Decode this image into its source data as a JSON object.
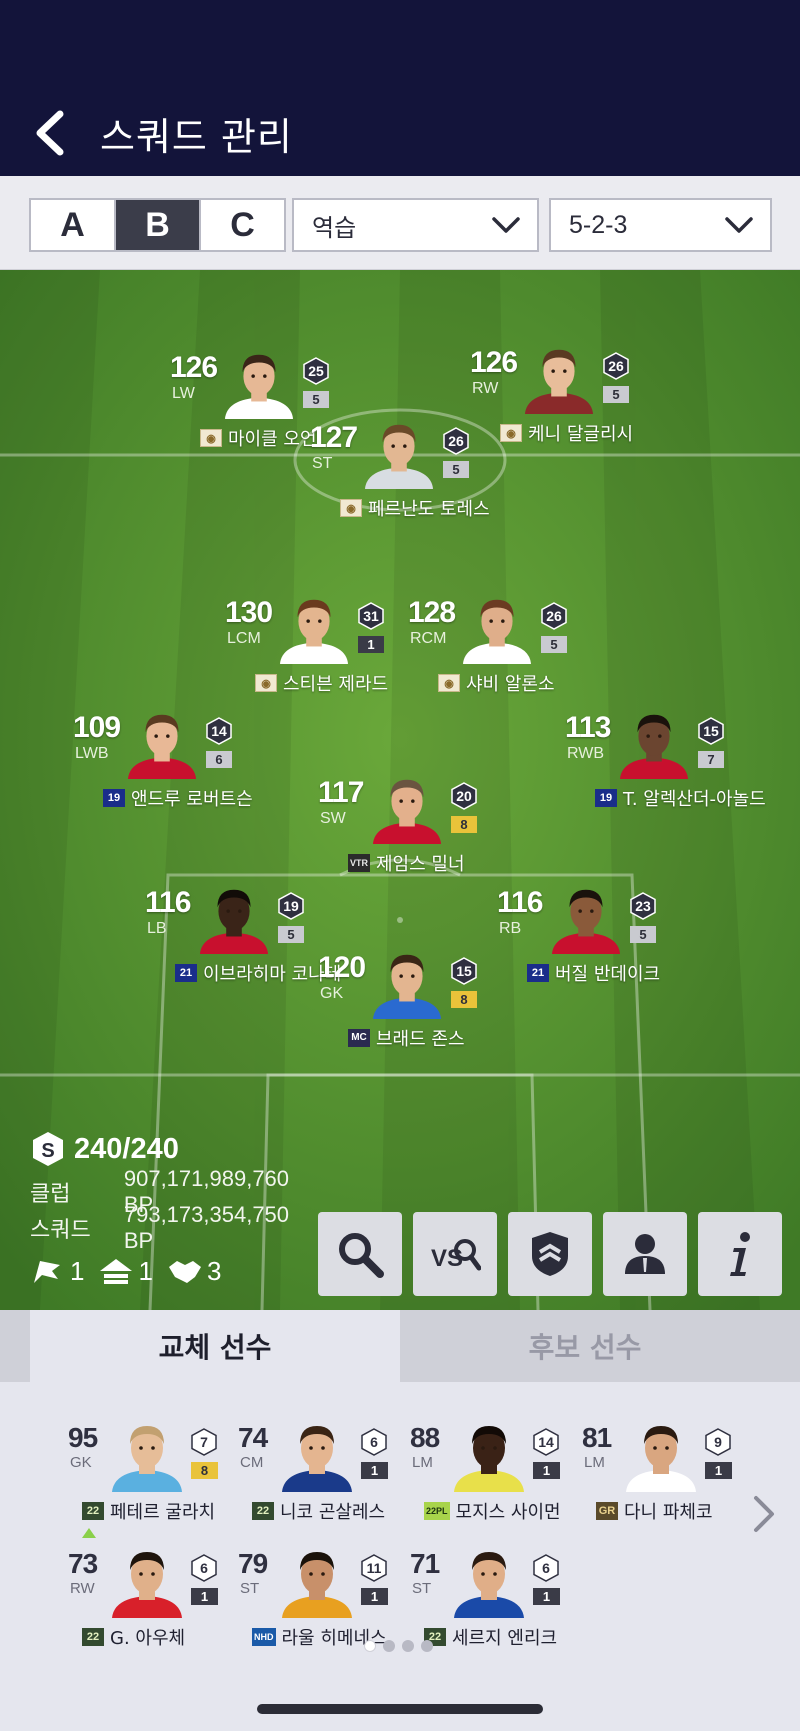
{
  "header": {
    "title": "스쿼드 관리"
  },
  "squad_tabs": [
    {
      "label": "A",
      "active": false
    },
    {
      "label": "B",
      "active": true
    },
    {
      "label": "C",
      "active": false
    }
  ],
  "tactic": {
    "selected": "역습"
  },
  "formation": {
    "selected": "5-2-3"
  },
  "pitch_players": [
    {
      "rating": "126",
      "pos": "LW",
      "badge": "25",
      "level": "5",
      "level_style": "gray",
      "season": "icon",
      "name": "마이클 오언",
      "kit": "#ffffff",
      "skin": "#e6b895",
      "hair": "#3a2518"
    },
    {
      "rating": "126",
      "pos": "RW",
      "badge": "26",
      "level": "5",
      "level_style": "gray",
      "season": "icon",
      "name": "케니 달글리시",
      "kit": "#8a2a2a",
      "skin": "#e8bd9a",
      "hair": "#5a3a22"
    },
    {
      "rating": "127",
      "pos": "ST",
      "badge": "26",
      "level": "5",
      "level_style": "gray",
      "season": "icon",
      "name": "페르난도 토레스",
      "kit": "#d8dde2",
      "skin": "#e2b792",
      "hair": "#6a4a28"
    },
    {
      "rating": "130",
      "pos": "LCM",
      "badge": "31",
      "level": "1",
      "level_style": "dark",
      "season": "icon",
      "name": "스티븐 제라드",
      "kit": "#ffffff",
      "skin": "#e3b58f",
      "hair": "#6a3a1e"
    },
    {
      "rating": "128",
      "pos": "RCM",
      "badge": "26",
      "level": "5",
      "level_style": "gray",
      "season": "icon",
      "name": "샤비 알론소",
      "kit": "#ffffff",
      "skin": "#dfae8a",
      "hair": "#6b3b22"
    },
    {
      "rating": "109",
      "pos": "LWB",
      "badge": "14",
      "level": "6",
      "level_style": "gray",
      "season": "19",
      "name": "앤드루 로버트슨",
      "kit": "#c8102e",
      "skin": "#e8b896",
      "hair": "#5a3a20"
    },
    {
      "rating": "113",
      "pos": "RWB",
      "badge": "15",
      "level": "7",
      "level_style": "gray",
      "season": "19",
      "name": "T. 알렉산더-아놀드",
      "kit": "#c8102e",
      "skin": "#6b4530",
      "hair": "#1a120c"
    },
    {
      "rating": "117",
      "pos": "SW",
      "badge": "20",
      "level": "8",
      "level_style": "gold",
      "season": "VTR",
      "name": "제임스 밀너",
      "kit": "#c8102e",
      "skin": "#e3b08c",
      "hair": "#6a5440"
    },
    {
      "rating": "116",
      "pos": "LB",
      "badge": "19",
      "level": "5",
      "level_style": "gray",
      "season": "21",
      "name": "이브라히마 코나테",
      "kit": "#c8102e",
      "skin": "#3a2418",
      "hair": "#120c08"
    },
    {
      "rating": "116",
      "pos": "RB",
      "badge": "23",
      "level": "5",
      "level_style": "gray",
      "season": "21",
      "name": "버질 반데이크",
      "kit": "#c8102e",
      "skin": "#8a5a3a",
      "hair": "#1a120c"
    },
    {
      "rating": "120",
      "pos": "GK",
      "badge": "15",
      "level": "8",
      "level_style": "gold",
      "season": "MC",
      "name": "브래드 존스",
      "kit": "#2a6ad0",
      "skin": "#e3b590",
      "hair": "#3a2616"
    }
  ],
  "stats": {
    "salary": "240/240",
    "club_label": "클럽",
    "club_value": "907,171,989,760 BP",
    "squad_label": "스쿼드",
    "squad_value": "793,173,354,750 BP",
    "chem_flag": "1",
    "chem_up": "1",
    "chem_hand": "3"
  },
  "actions": [
    "search-icon",
    "vs-search-icon",
    "shield-icon",
    "person-icon",
    "info-icon"
  ],
  "panel": {
    "tab_active": "교체 선수",
    "tab_inactive": "후보 선수"
  },
  "subs": [
    {
      "rating": "95",
      "pos": "GK",
      "badge": "7",
      "level": "8",
      "level_style": "gold",
      "season": "22",
      "name": "페테르 굴라치",
      "kit": "#5ab0e0",
      "skin": "#e6bd98",
      "hair": "#c2a070",
      "up": false
    },
    {
      "rating": "74",
      "pos": "CM",
      "badge": "6",
      "level": "1",
      "level_style": "dark",
      "season": "22",
      "name": "니코 곤살레스",
      "kit": "#1a3a8a",
      "skin": "#e4b590",
      "hair": "#3a2414",
      "up": false
    },
    {
      "rating": "88",
      "pos": "LM",
      "badge": "14",
      "level": "1",
      "level_style": "dark",
      "season": "22PL",
      "name": "모지스 사이먼",
      "kit": "#e8e04a",
      "skin": "#3a2216",
      "hair": "#120a06",
      "up": false
    },
    {
      "rating": "81",
      "pos": "LM",
      "badge": "9",
      "level": "1",
      "level_style": "dark",
      "season": "GR",
      "name": "다니 파체코",
      "kit": "#ffffff",
      "skin": "#d9a680",
      "hair": "#2a1a10",
      "up": false
    },
    {
      "rating": "73",
      "pos": "RW",
      "badge": "6",
      "level": "1",
      "level_style": "dark",
      "season": "22",
      "name": "G. 아우체",
      "kit": "#d8202a",
      "skin": "#e0b08a",
      "hair": "#1e140c",
      "up": true
    },
    {
      "rating": "79",
      "pos": "ST",
      "badge": "11",
      "level": "1",
      "level_style": "dark",
      "season": "NHD",
      "name": "라울 히메네스",
      "kit": "#e8a020",
      "skin": "#c8906a",
      "hair": "#1a120a",
      "up": false
    },
    {
      "rating": "71",
      "pos": "ST",
      "badge": "6",
      "level": "1",
      "level_style": "dark",
      "season": "22",
      "name": "세르지 엔리크",
      "kit": "#1a4aa8",
      "skin": "#e0ae88",
      "hair": "#2a1a10",
      "up": false
    }
  ],
  "pager": {
    "count": 4,
    "active": 0
  }
}
